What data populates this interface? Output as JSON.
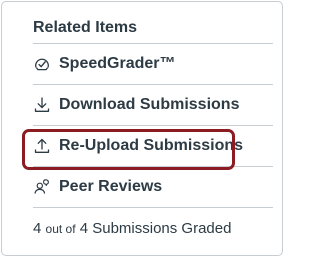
{
  "related_items": {
    "heading": "Related Items",
    "items": [
      {
        "label": "SpeedGrader™",
        "icon": "speedgrader-icon"
      },
      {
        "label": "Download Submissions",
        "icon": "download-icon"
      },
      {
        "label": "Re-Upload Submissions",
        "icon": "upload-icon"
      },
      {
        "label": "Peer Reviews",
        "icon": "peer-reviews-icon"
      }
    ],
    "summary": {
      "graded": "4",
      "connector": "out of",
      "total_text": "4 Submissions Graded"
    }
  },
  "colors": {
    "text": "#2d3b45",
    "border": "#c7cdd1",
    "highlight": "#8c1c24"
  }
}
